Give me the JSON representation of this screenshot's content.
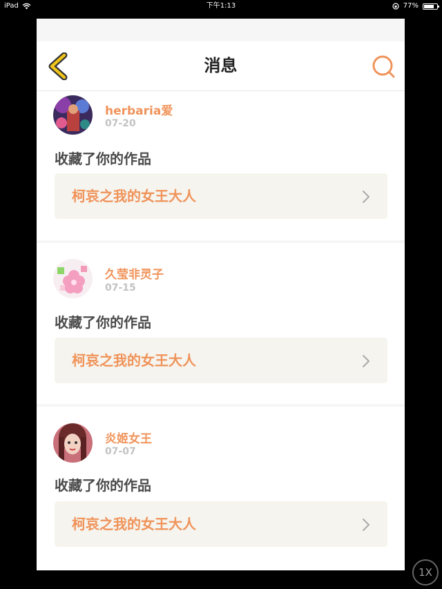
{
  "status_bar": {
    "device": "iPad",
    "time": "下午1:13",
    "battery": "77%",
    "battery_level": 0.77
  },
  "nav": {
    "title": "消息",
    "back_icon": "chevron-left-icon",
    "search_icon": "search-icon"
  },
  "notifications": [
    {
      "username": "herbaria爱",
      "date": "07-20",
      "action": "收藏了你的作品",
      "work_title": "柯哀之我的女王大人"
    },
    {
      "username": "久莹非灵子",
      "date": "07-15",
      "action": "收藏了你的作品",
      "work_title": "柯哀之我的女王大人"
    },
    {
      "username": "炎姬女王",
      "date": "07-07",
      "action": "收藏了你的作品",
      "work_title": "柯哀之我的女王大人"
    }
  ],
  "zoom_button": {
    "label": "1X"
  },
  "colors": {
    "accent": "#f0935a",
    "back_arrow": "#f0c419",
    "work_bg": "#f5f4ee"
  }
}
